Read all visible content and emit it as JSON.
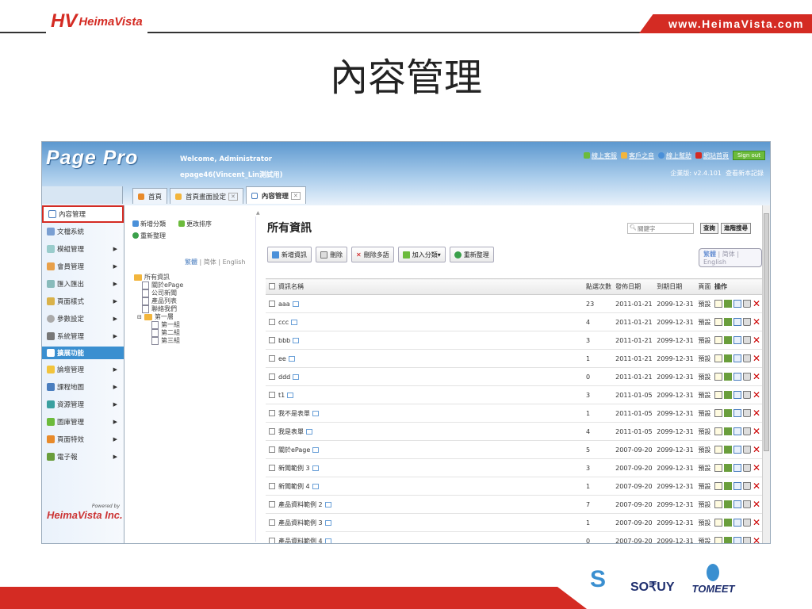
{
  "slide": {
    "url": "www.HeimaVista.com",
    "logo_mark": "HV",
    "logo_name": "HeimaVista",
    "title": "內容管理",
    "partners": [
      "S",
      "SO₹UY",
      "TOMEET"
    ]
  },
  "app": {
    "brand": "Page Pro",
    "welcome": "Welcome, Administrator",
    "account": "epage46(Vincent_Lin測試用)",
    "links": [
      "線上客服",
      "客戶之音",
      "線上幫助",
      "網站首頁"
    ],
    "signout": "Sign out",
    "version": "企業版: v2.4.101",
    "update_log": "查看新本記錄",
    "tabs": [
      {
        "label": "首頁",
        "closable": false
      },
      {
        "label": "首頁畫面設定",
        "closable": true
      },
      {
        "label": "內容管理",
        "closable": true
      }
    ],
    "sidebar": [
      {
        "label": "內容管理",
        "arrow": false
      },
      {
        "label": "文檔系統",
        "arrow": false
      },
      {
        "label": "模組管理",
        "arrow": true
      },
      {
        "label": "會員管理",
        "arrow": true
      },
      {
        "label": "匯入匯出",
        "arrow": true
      },
      {
        "label": "頁面樣式",
        "arrow": true
      },
      {
        "label": "參數設定",
        "arrow": true
      },
      {
        "label": "系統管理",
        "arrow": true
      },
      {
        "label": "擴展功能",
        "arrow": false
      },
      {
        "label": "論壇管理",
        "arrow": true
      },
      {
        "label": "課程地圖",
        "arrow": true
      },
      {
        "label": "資源管理",
        "arrow": true
      },
      {
        "label": "圖庫管理",
        "arrow": true
      },
      {
        "label": "頁面特效",
        "arrow": true
      },
      {
        "label": "電子報",
        "arrow": true
      }
    ],
    "powered_by": "Powered by",
    "powered_logo": "HeimaVista Inc.",
    "tree": {
      "add_category": "新增分類",
      "reorder": "更改排序",
      "reorganize": "重新整理",
      "lang": [
        "繁體",
        "简体",
        "English"
      ],
      "nodes": [
        {
          "label": "所有資訊",
          "level": 0,
          "folder": true
        },
        {
          "label": "關於ePage",
          "level": 1,
          "folder": false
        },
        {
          "label": "公司新聞",
          "level": 1,
          "folder": false
        },
        {
          "label": "產品列表",
          "level": 1,
          "folder": false
        },
        {
          "label": "聯絡我們",
          "level": 1,
          "folder": false
        },
        {
          "label": "第一層",
          "level": 1,
          "folder": true
        },
        {
          "label": "第一組",
          "level": 2,
          "folder": false
        },
        {
          "label": "第二組",
          "level": 2,
          "folder": false
        },
        {
          "label": "第三組",
          "level": 2,
          "folder": false
        }
      ]
    },
    "main": {
      "title": "所有資訊",
      "search_placeholder": "關鍵字",
      "search_btn": "查詢",
      "adv_btn": "進階搜尋",
      "toolbar": [
        "新增資訊",
        "刪除",
        "刪除多語",
        "加入分類▾",
        "重新整理"
      ],
      "lang": [
        "繁體",
        "简体",
        "English"
      ],
      "columns": [
        "資訊名稱",
        "點選次數",
        "發佈日期",
        "到期日期",
        "頁面",
        "操作"
      ],
      "rows": [
        [
          "aaa",
          "23",
          "2011-01-21",
          "2099-12-31",
          "預設"
        ],
        [
          "ccc",
          "4",
          "2011-01-21",
          "2099-12-31",
          "預設"
        ],
        [
          "bbb",
          "3",
          "2011-01-21",
          "2099-12-31",
          "預設"
        ],
        [
          "ee",
          "1",
          "2011-01-21",
          "2099-12-31",
          "預設"
        ],
        [
          "ddd",
          "0",
          "2011-01-21",
          "2099-12-31",
          "預設"
        ],
        [
          "t1",
          "3",
          "2011-01-05",
          "2099-12-31",
          "預設"
        ],
        [
          "我不是表單",
          "1",
          "2011-01-05",
          "2099-12-31",
          "預設"
        ],
        [
          "我是表單",
          "4",
          "2011-01-05",
          "2099-12-31",
          "預設"
        ],
        [
          "關於ePage",
          "5",
          "2007-09-20",
          "2099-12-31",
          "預設"
        ],
        [
          "新聞範例 3",
          "3",
          "2007-09-20",
          "2099-12-31",
          "預設"
        ],
        [
          "新聞範例 4",
          "1",
          "2007-09-20",
          "2099-12-31",
          "預設"
        ],
        [
          "產品資料範例 2",
          "7",
          "2007-09-20",
          "2099-12-31",
          "預設"
        ],
        [
          "產品資料範例 3",
          "1",
          "2007-09-20",
          "2099-12-31",
          "預設"
        ],
        [
          "產品資料範例 4",
          "0",
          "2007-09-20",
          "2099-12-31",
          "預設"
        ]
      ]
    }
  }
}
